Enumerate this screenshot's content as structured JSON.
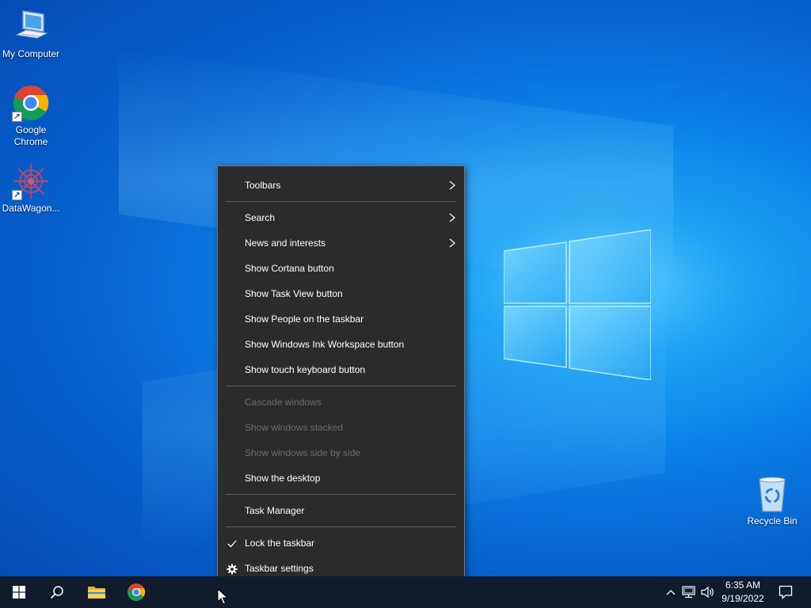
{
  "desktop": {
    "icons": [
      {
        "label": "My Computer",
        "icon": "computer-icon"
      },
      {
        "label": "Google\nChrome",
        "icon": "chrome-icon"
      },
      {
        "label": "DataWagon...",
        "icon": "datawagon-icon"
      },
      {
        "label": "Recycle Bin",
        "icon": "recycle-bin-icon"
      }
    ]
  },
  "context_menu": {
    "items": [
      {
        "label": "Toolbars",
        "submenu": true
      },
      {
        "label": "Search",
        "submenu": true
      },
      {
        "label": "News and interests",
        "submenu": true
      },
      {
        "label": "Show Cortana button"
      },
      {
        "label": "Show Task View button"
      },
      {
        "label": "Show People on the taskbar"
      },
      {
        "label": "Show Windows Ink Workspace button"
      },
      {
        "label": "Show touch keyboard button"
      },
      {
        "label": "Cascade windows",
        "disabled": true
      },
      {
        "label": "Show windows stacked",
        "disabled": true
      },
      {
        "label": "Show windows side by side",
        "disabled": true
      },
      {
        "label": "Show the desktop"
      },
      {
        "label": "Task Manager"
      },
      {
        "label": "Lock the taskbar",
        "checked": true
      },
      {
        "label": "Taskbar settings",
        "icon": "gear-icon"
      }
    ]
  },
  "taskbar": {
    "pinned": [
      {
        "name": "start",
        "icon": "windows-logo-icon"
      },
      {
        "name": "search",
        "icon": "search-icon"
      },
      {
        "name": "file-explorer",
        "icon": "folder-icon"
      },
      {
        "name": "chrome",
        "icon": "chrome-icon"
      }
    ],
    "tray_icons": [
      "chevron-up-icon",
      "network-icon",
      "volume-icon",
      "notification-icon"
    ],
    "time": "6:35 AM",
    "date": "9/19/2022"
  },
  "colors": {
    "menu_bg": "#2b2b2b",
    "taskbar_bg": "#101b2c",
    "desktop_accent": "#0a82e8"
  }
}
